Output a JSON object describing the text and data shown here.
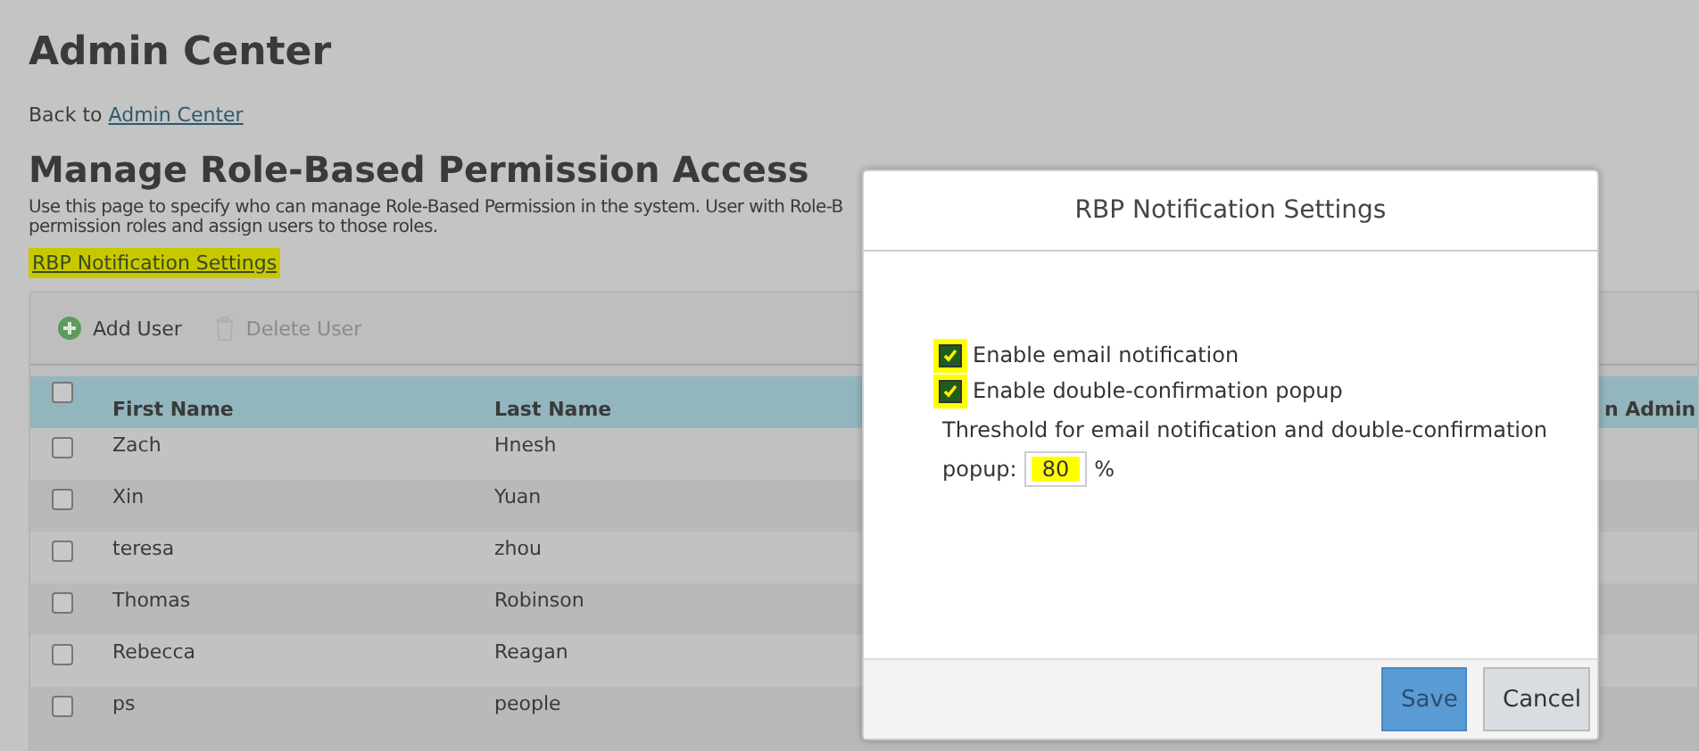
{
  "page": {
    "title": "Admin Center",
    "back_text": "Back to",
    "back_link": "Admin Center",
    "heading": "Manage Role-Based Permission Access",
    "description": [
      "Use this page to specify who can manage Role-Based Permission in the system. User with Role-B",
      "permission roles and assign users to those roles."
    ],
    "settings_link": {
      "label": "RBP Notification Settings",
      "highlighted": true
    }
  },
  "toolbar": [
    {
      "label": "Add User",
      "disabled": false
    },
    {
      "label": "Delete User",
      "disabled": true
    }
  ],
  "table": {
    "header_checked": false,
    "columns": [
      "First Name",
      "Last Name",
      "n Admin"
    ],
    "rows": [
      {
        "checked": false,
        "cells": [
          "Zach",
          "Hnesh"
        ]
      },
      {
        "checked": false,
        "cells": [
          "Xin",
          "Yuan"
        ]
      },
      {
        "checked": false,
        "cells": [
          "teresa",
          "zhou"
        ]
      },
      {
        "checked": false,
        "cells": [
          "Thomas",
          "Robinson"
        ]
      },
      {
        "checked": false,
        "cells": [
          "Rebecca",
          "Reagan"
        ]
      },
      {
        "checked": false,
        "cells": [
          "ps",
          "people"
        ]
      }
    ]
  },
  "dialog": {
    "title": "RBP Notification Settings",
    "options": [
      {
        "label": "Enable email notification",
        "checked": true,
        "highlighted": true
      },
      {
        "label": "Enable double-confirmation popup",
        "checked": true,
        "highlighted": true
      }
    ],
    "threshold_label_1": "Threshold for email notification and double-confirmation",
    "threshold_label_2": "popup:",
    "threshold_value": "80",
    "threshold_value_highlighted": true,
    "threshold_unit": "%",
    "buttons": [
      {
        "label": "Save",
        "kind": "primary"
      },
      {
        "label": "Cancel",
        "kind": "secondary"
      }
    ]
  }
}
